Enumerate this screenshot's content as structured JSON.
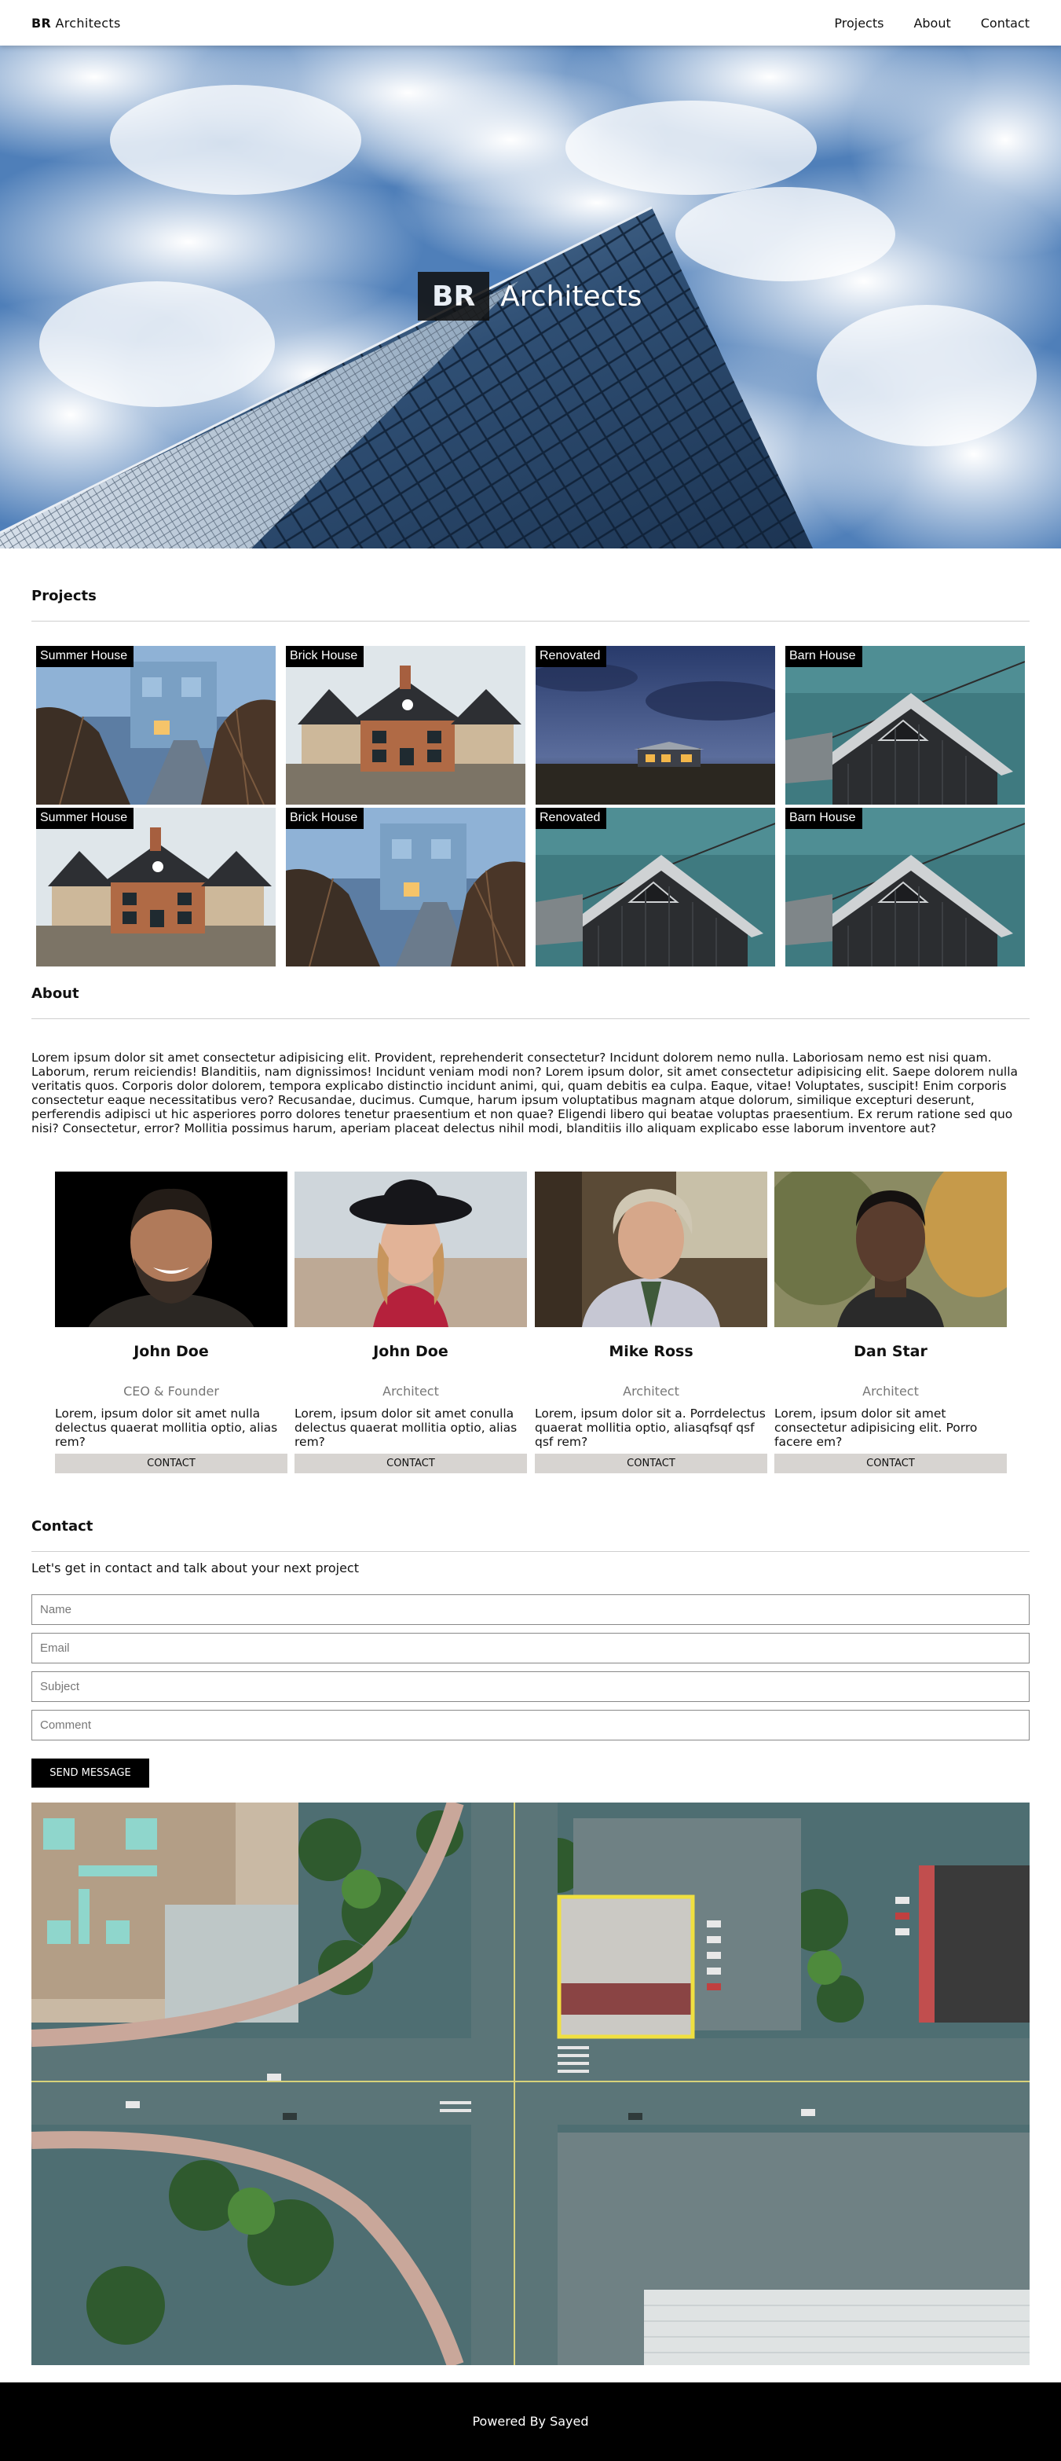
{
  "header": {
    "brand_bold": "BR",
    "brand_rest": " Architects",
    "nav": [
      "Projects",
      "About",
      "Contact"
    ]
  },
  "hero": {
    "badge": "BR",
    "title": "Architects"
  },
  "projects": {
    "heading": "Projects",
    "items": [
      {
        "label": "Summer House",
        "image": "modern-house-night-photo"
      },
      {
        "label": "Brick House",
        "image": "brick-house-photo"
      },
      {
        "label": "Renovated",
        "image": "house-at-dusk-photo"
      },
      {
        "label": "Barn House",
        "image": "barn-house-photo"
      },
      {
        "label": "Summer House",
        "image": "brick-house-photo"
      },
      {
        "label": "Brick House",
        "image": "modern-house-night-photo"
      },
      {
        "label": "Renovated",
        "image": "barn-house-photo"
      },
      {
        "label": "Barn House",
        "image": "barn-house-photo"
      }
    ]
  },
  "about": {
    "heading": "About",
    "text": "Lorem ipsum dolor sit amet consectetur adipisicing elit. Provident, reprehenderit consectetur? Incidunt dolorem nemo nulla. Laboriosam nemo est nisi quam. Laborum, rerum reiciendis! Blanditiis, nam dignissimos! Incidunt veniam modi non? Lorem ipsum dolor, sit amet consectetur adipisicing elit. Saepe dolorem nulla veritatis quos. Corporis dolor dolorem, tempora explicabo distinctio incidunt animi, qui, quam debitis ea culpa. Eaque, vitae! Voluptates, suscipit! Enim corporis consectetur eaque necessitatibus vero? Recusandae, ducimus. Cumque, harum ipsum voluptatibus magnam atque dolorum, similique excepturi deserunt, perferendis adipisci ut hic asperiores porro dolores tenetur praesentium et non quae? Eligendi libero qui beatae voluptas praesentium. Ex rerum ratione sed quo nisi? Consectetur, error? Mollitia possimus harum, aperiam placeat delectus nihil modi, blanditiis illo aliquam explicabo esse laborum inventore aut?"
  },
  "team": [
    {
      "name": "John Doe",
      "role": "CEO & Founder",
      "bio": "Lorem, ipsum dolor sit amet nulla delectus quaerat mollitia optio, alias rem?",
      "button": "CONTACT",
      "photo": "bearded-man-portrait"
    },
    {
      "name": "John Doe",
      "role": "Architect",
      "bio": "Lorem, ipsum dolor sit amet conulla delectus quaerat mollitia optio, alias rem?",
      "button": "CONTACT",
      "photo": "woman-in-hat-portrait"
    },
    {
      "name": "Mike Ross",
      "role": "Architect",
      "bio": "Lorem, ipsum dolor sit a. Porrdelectus quaerat mollitia optio, aliasqfsqf qsf qsf rem?",
      "button": "CONTACT",
      "photo": "older-man-portrait"
    },
    {
      "name": "Dan Star",
      "role": "Architect",
      "bio": "Lorem, ipsum dolor sit amet consectetur adipisicing elit. Porro facere em?",
      "button": "CONTACT",
      "photo": "young-man-portrait"
    }
  ],
  "contact": {
    "heading": "Contact",
    "subtitle": "Let's get in contact and talk about your next project",
    "fields": {
      "name_placeholder": "Name",
      "email_placeholder": "Email",
      "subject_placeholder": "Subject",
      "comment_placeholder": "Comment"
    },
    "send_label": "SEND MESSAGE"
  },
  "map": {
    "image": "aerial-city-map-photo"
  },
  "footer": {
    "text": "Powered By Sayed"
  },
  "colors": {
    "accent_dark": "#000000",
    "button_gray": "#d7d4d1",
    "rule": "#cfcfcf"
  }
}
